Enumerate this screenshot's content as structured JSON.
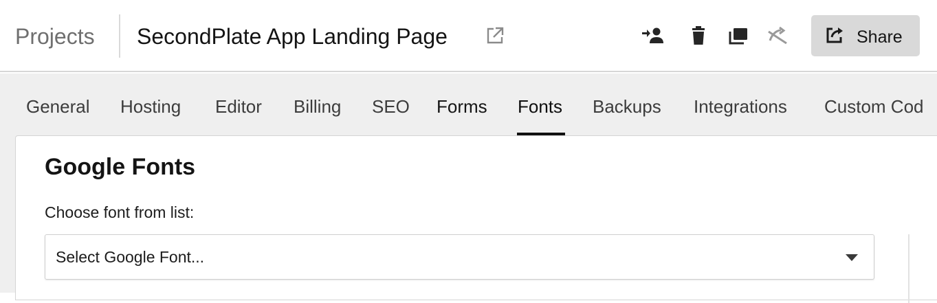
{
  "header": {
    "breadcrumb_root": "Projects",
    "project_title": "SecondPlate App Landing Page",
    "icons": {
      "external_link": "external-link-icon",
      "transfer": "transfer-user-icon",
      "delete": "trash-icon",
      "duplicate": "duplicate-icon",
      "unpublish": "unpublish-icon",
      "share": "share-icon"
    },
    "share_label": "Share"
  },
  "tabs": [
    {
      "label": "General"
    },
    {
      "label": "Hosting"
    },
    {
      "label": "Editor"
    },
    {
      "label": "Billing"
    },
    {
      "label": "SEO"
    },
    {
      "label": "Forms"
    },
    {
      "label": "Fonts",
      "active": true
    },
    {
      "label": "Backups"
    },
    {
      "label": "Integrations"
    },
    {
      "label": "Custom Cod"
    }
  ],
  "fonts_panel": {
    "title": "Google Fonts",
    "choose_label": "Choose font from list:",
    "select_value": "Select Google Font..."
  },
  "colors": {
    "accent": "#111111",
    "tab_bar_bg": "#efefef",
    "share_button_bg": "#d9d9d9"
  }
}
